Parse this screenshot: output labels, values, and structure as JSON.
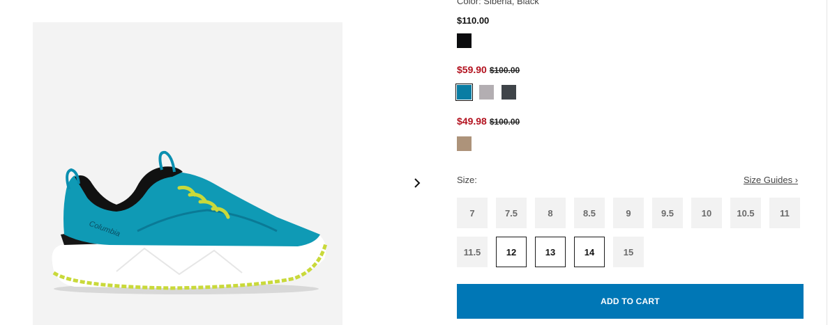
{
  "product": {
    "color_label": "Color: Siberia, Black",
    "image_logo_text": "Columbia"
  },
  "price_groups": [
    {
      "price": "$110.00",
      "swatches": [
        {
          "name": "black",
          "color": "#0b0c0e"
        }
      ]
    },
    {
      "sale_price": "$59.90",
      "original_price": "$100.00",
      "swatches": [
        {
          "name": "siberia-teal",
          "color": "#0a7da3",
          "selected": true
        },
        {
          "name": "light-gray",
          "color": "#b3aeb2"
        },
        {
          "name": "dark-gray",
          "color": "#3f4449"
        }
      ]
    },
    {
      "sale_price": "$49.98",
      "original_price": "$100.00",
      "swatches": [
        {
          "name": "tan",
          "color": "#ad937a"
        }
      ]
    }
  ],
  "size": {
    "label": "Size:",
    "guides_link": "Size Guides ›",
    "options": [
      "7",
      "7.5",
      "8",
      "8.5",
      "9",
      "9.5",
      "10",
      "10.5",
      "11",
      "11.5",
      "12",
      "13",
      "14",
      "15"
    ],
    "available": [
      "12",
      "13",
      "14"
    ]
  },
  "cart": {
    "button_label": "ADD TO CART"
  },
  "icons": {
    "next": "chevron-right-icon"
  },
  "colors": {
    "sale": "#b3121f",
    "cta": "#0077b6"
  }
}
